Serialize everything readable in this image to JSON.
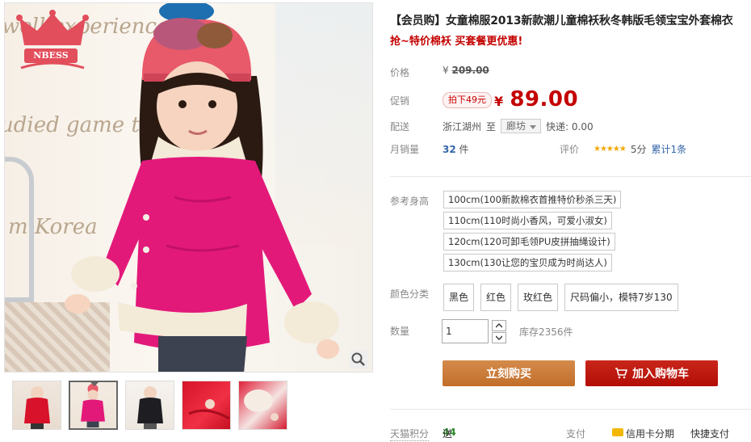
{
  "gallery": {
    "brand_logo_text": "NBESS",
    "wall_text": [
      "well experienced",
      "udied game theory",
      "m Korea"
    ],
    "thumb_count": 5,
    "active_thumb": 2
  },
  "product": {
    "title": "【会员购】女童棉服2013新款潮儿童棉袄秋冬韩版毛领宝宝外套棉衣",
    "subtitle": "抢~特价棉袄 买套餐更优惠!",
    "price_label": "价格",
    "original_price_currency": "¥",
    "original_price": "209.00",
    "promo_label": "促销",
    "promo_tag": "拍下49元",
    "promo_price_currency": "¥",
    "promo_price": "89.00",
    "shipping_label": "配送",
    "ship_from": "浙江湖州",
    "ship_to_word": "至",
    "ship_to": "廊坊",
    "express_fee": "快递: 0.00",
    "monthly_sales_label": "月销量",
    "monthly_sales_count": "32",
    "monthly_sales_unit": "件",
    "rating_label": "评价",
    "rating_stars": "★★★★★",
    "rating_score": "5分",
    "rating_total": "累计1条",
    "size_label": "参考身高",
    "sizes": [
      "100cm(100新款棉衣首推特价秒杀三天)",
      "110cm(110时尚小香风，可爱小淑女)",
      "120cm(120可卸毛领PU皮拼抽绳设计)",
      "130cm(130让您的宝贝成为时尚达人)"
    ],
    "color_label": "颜色分类",
    "colors": [
      "黑色",
      "红色",
      "玫红色",
      "尺码偏小，模特7岁130"
    ],
    "qty_label": "数量",
    "qty_value": "1",
    "stock": "库存2356件",
    "buy_now": "立刻购买",
    "add_cart": "加入购物车"
  },
  "footer": {
    "points_label": "天猫积分",
    "points_prefix": "送",
    "points_value": "44",
    "pay_label": "支付",
    "credit_installment": "信用卡分期",
    "quick_pay": "快捷支付"
  },
  "colors": {
    "accent_red": "#c40000",
    "buy_button": "#c8742f",
    "cart_button": "#be1a10",
    "coat_pink": "#e3197a"
  }
}
